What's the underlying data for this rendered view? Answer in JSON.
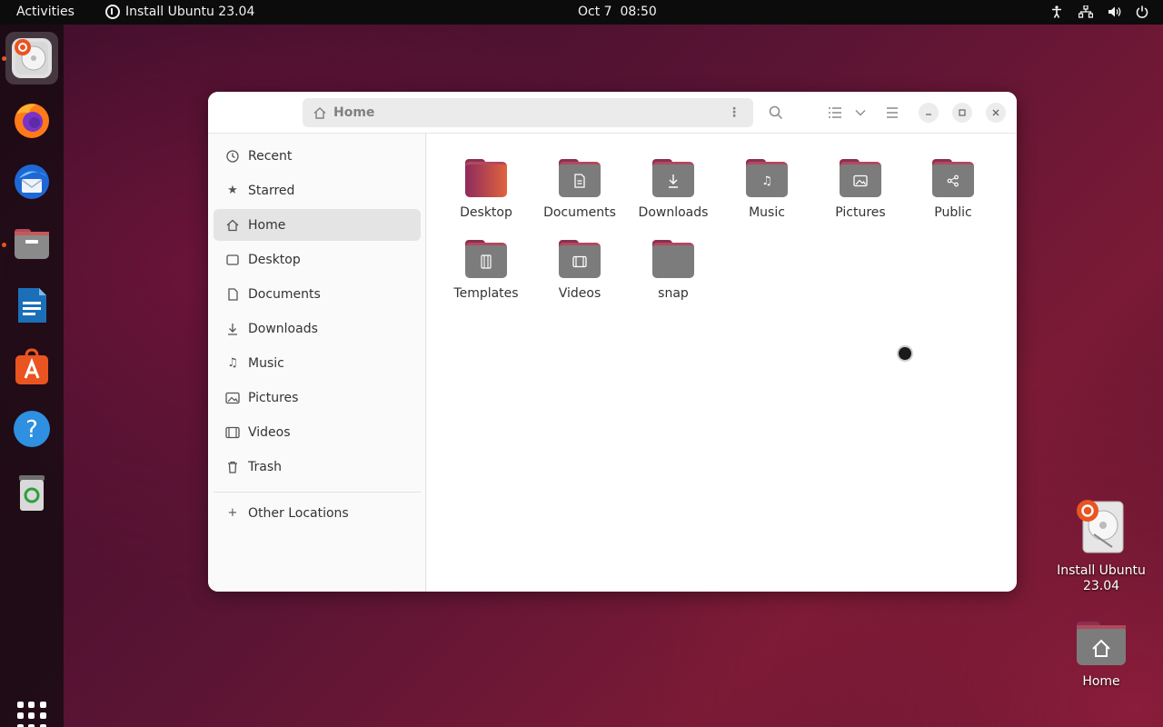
{
  "topbar": {
    "activities": "Activities",
    "app_menu": "Install Ubuntu 23.04",
    "clock": "Oct 7  08:50",
    "tray_icons": [
      "accessibility-icon",
      "network-icon",
      "volume-icon",
      "power-icon"
    ]
  },
  "dock": {
    "items": [
      {
        "name": "install-ubuntu",
        "active": true,
        "running": true
      },
      {
        "name": "firefox",
        "active": false,
        "running": false
      },
      {
        "name": "thunderbird",
        "active": false,
        "running": false
      },
      {
        "name": "files",
        "active": false,
        "running": true
      },
      {
        "name": "libreoffice-writer",
        "active": false,
        "running": false
      },
      {
        "name": "app-center",
        "active": false,
        "running": false
      },
      {
        "name": "help",
        "active": false,
        "running": false
      },
      {
        "name": "trash",
        "active": false,
        "running": false
      }
    ],
    "show_apps": "show-applications-icon"
  },
  "window": {
    "path_label": "Home",
    "sidebar": {
      "items": [
        {
          "label": "Recent",
          "icon": "clock-icon"
        },
        {
          "label": "Starred",
          "icon": "star-icon"
        },
        {
          "label": "Home",
          "icon": "home-icon",
          "selected": true
        },
        {
          "label": "Desktop",
          "icon": "desktop-icon"
        },
        {
          "label": "Documents",
          "icon": "document-icon"
        },
        {
          "label": "Downloads",
          "icon": "download-icon"
        },
        {
          "label": "Music",
          "icon": "music-icon"
        },
        {
          "label": "Pictures",
          "icon": "picture-icon"
        },
        {
          "label": "Videos",
          "icon": "video-icon"
        },
        {
          "label": "Trash",
          "icon": "trash-icon"
        }
      ],
      "other_locations": "Other Locations"
    },
    "folders": [
      {
        "label": "Desktop",
        "icon": "desktop-folder-icon"
      },
      {
        "label": "Documents",
        "icon": "documents-folder-icon"
      },
      {
        "label": "Downloads",
        "icon": "downloads-folder-icon"
      },
      {
        "label": "Music",
        "icon": "music-folder-icon"
      },
      {
        "label": "Pictures",
        "icon": "pictures-folder-icon"
      },
      {
        "label": "Public",
        "icon": "public-folder-icon"
      },
      {
        "label": "Templates",
        "icon": "templates-folder-icon"
      },
      {
        "label": "Videos",
        "icon": "videos-folder-icon"
      },
      {
        "label": "snap",
        "icon": "folder-icon"
      }
    ]
  },
  "desktop_icons": [
    {
      "label": "Install Ubuntu 23.04"
    },
    {
      "label": "Home"
    }
  ],
  "colors": {
    "ubuntu_orange": "#e95420",
    "folder_accent": "#b04a5e",
    "folder_body": "#7c7c7c"
  }
}
